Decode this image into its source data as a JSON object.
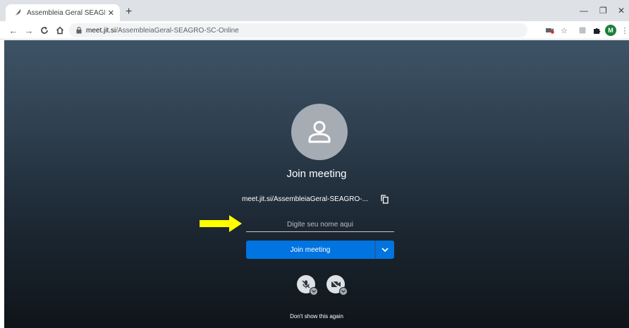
{
  "browser": {
    "tab_title": "Assembleia Geral SEAGRO SC On",
    "new_tab_label": "+",
    "url_host": "meet.jit.si",
    "url_path": "/AssembleiaGeral-SEAGRO-SC-Online",
    "profile_initial": "M"
  },
  "meeting": {
    "title": "Join meeting",
    "room_url": "meet.jit.si/AssembleiaGeral-SEAGRO-...",
    "name_placeholder": "Digite seu nome aqui",
    "join_label": "Join meeting",
    "dont_show_label": "Don't show this again"
  },
  "colors": {
    "accent": "#0074e0",
    "arrow": "#ffff00",
    "profile": "#188038"
  }
}
